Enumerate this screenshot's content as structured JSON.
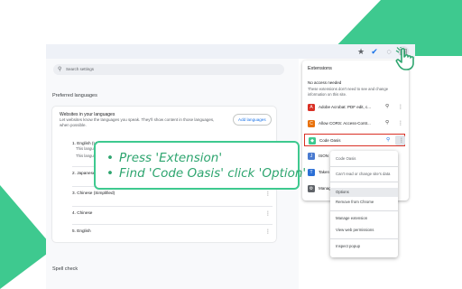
{
  "colors": {
    "accent_green": "#3ec98f",
    "callout_text": "#2ea56f",
    "highlight_red": "#d93025",
    "link_blue": "#1a73e8"
  },
  "toolbar": {
    "icons": [
      "star-icon",
      "check-circle-icon",
      "puzzle-icon",
      "extensions-icon"
    ]
  },
  "settings": {
    "search_placeholder": "Search settings",
    "preferred_languages_title": "Preferred languages",
    "card": {
      "heading": "Websites in your languages",
      "description": "Let websites know the languages you speak. They'll show content in those languages, when possible.",
      "add_button": "Add languages",
      "languages": [
        {
          "label": "1. English (U",
          "sub": "This langua"
        },
        {
          "label": "",
          "sub": "This languag"
        },
        {
          "label": "2. Japanese",
          "sub": ""
        },
        {
          "label": "3. Chinese (Simplified)",
          "sub": ""
        },
        {
          "label": "4. Chinese",
          "sub": ""
        },
        {
          "label": "5. English",
          "sub": ""
        }
      ]
    },
    "spell_check_title": "Spell check"
  },
  "extensions_panel": {
    "title": "Extensions",
    "close": "×",
    "section": "No access needed",
    "description": "These extensions don't need to see and change information on this site.",
    "items": [
      {
        "name": "Adobe Acrobat: PDF edit, c...",
        "icon_color": "#d93025",
        "icon": "A"
      },
      {
        "name": "Allow CORS: Access-Contr...",
        "icon_color": "#e8710a",
        "icon": "C"
      },
      {
        "name": "Code Oasis",
        "icon_color": "#3ec98f",
        "icon": "◆"
      },
      {
        "name": "ISON",
        "icon_color": "#4a7bd0",
        "icon": "J"
      },
      {
        "name": "Taken",
        "icon_color": "#2b6fd6",
        "icon": "T"
      },
      {
        "name": "Manag",
        "icon_color": "#5f6368",
        "icon": "⚙"
      }
    ]
  },
  "context_menu": {
    "items": [
      "Code Oasis",
      "Can't read or change site's data",
      "Options",
      "Remove from Chrome",
      "Manage extension",
      "View web permissions",
      "Inspect popup"
    ]
  },
  "callout": {
    "lines": [
      "Press 'Extension'",
      "Find 'Code Oasis' click 'Option'"
    ]
  }
}
